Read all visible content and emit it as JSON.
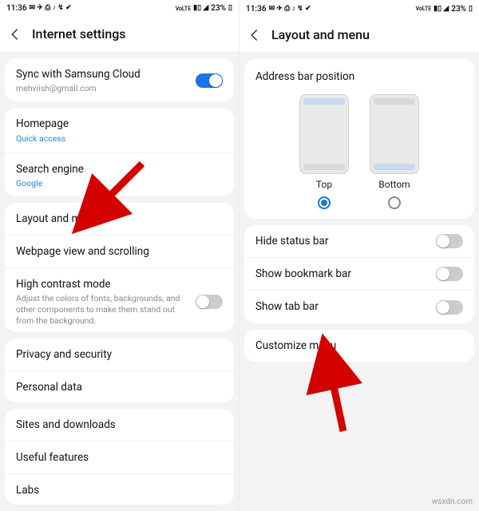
{
  "status": {
    "time": "11:36",
    "battery": "23%",
    "carrier": "VoLTE"
  },
  "left": {
    "title": "Internet settings",
    "sync": {
      "title": "Sync with Samsung Cloud",
      "account": "mehviish@gmail.com",
      "on": true
    },
    "homepage": {
      "title": "Homepage",
      "value": "Quick access"
    },
    "search_engine": {
      "title": "Search engine",
      "value": "Google"
    },
    "layout_menu": {
      "title": "Layout and menu"
    },
    "webpage_view": {
      "title": "Webpage view and scrolling"
    },
    "high_contrast": {
      "title": "High contrast mode",
      "desc": "Adjust the colors of fonts, backgrounds, and other components to make them stand out from the background.",
      "on": false
    },
    "privacy": {
      "title": "Privacy and security"
    },
    "personal_data": {
      "title": "Personal data"
    },
    "sites_downloads": {
      "title": "Sites and downloads"
    },
    "useful_features": {
      "title": "Useful features"
    },
    "labs": {
      "title": "Labs"
    }
  },
  "right": {
    "title": "Layout and menu",
    "address_bar": {
      "section_title": "Address bar position",
      "top_label": "Top",
      "bottom_label": "Bottom",
      "selected": "top"
    },
    "hide_status_bar": {
      "title": "Hide status bar",
      "on": false
    },
    "show_bookmark_bar": {
      "title": "Show bookmark bar",
      "on": false
    },
    "show_tab_bar": {
      "title": "Show tab bar",
      "on": false
    },
    "customize_menu": {
      "title": "Customize menu"
    }
  },
  "watermark": "wsxdn.com"
}
